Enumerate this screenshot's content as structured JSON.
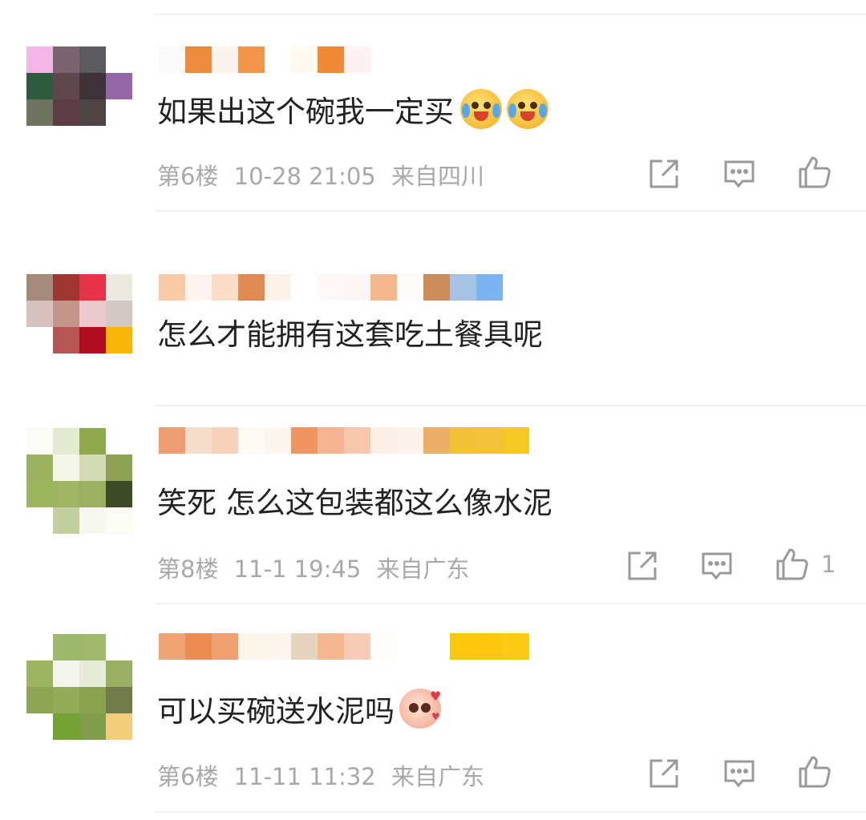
{
  "comments": [
    {
      "avatar_colors": [
        "#ffffff",
        "#ffffff",
        "#ffffff",
        "#ffffff",
        "#ffffff",
        "#ffffff",
        "#ffffff",
        "#ffffff",
        "#ffffff",
        "#ffffff",
        "#ffffff",
        "#ffffff"
      ],
      "text": "如果出这个碗我一定买",
      "floor": "第6楼",
      "time": "10-28 21:05",
      "location": "来自四川",
      "likes": ""
    },
    {
      "text": "怎么才能拥有这套吃土餐具呢"
    },
    {
      "text": "笑死 怎么这包装都这么像水泥",
      "floor": "第8楼",
      "time": "11-1 19:45",
      "location": "来自广东",
      "likes": "1"
    },
    {
      "text": "可以买碗送水泥吗",
      "floor": "第6楼",
      "time": "11-11 11:32",
      "location": "来自广东",
      "likes": ""
    }
  ],
  "icons": {
    "share": "share-icon",
    "comment": "comment-icon",
    "like": "like-icon"
  },
  "colors": {
    "text": "#222222",
    "meta": "#a8a8a8",
    "divider": "#efefef"
  }
}
